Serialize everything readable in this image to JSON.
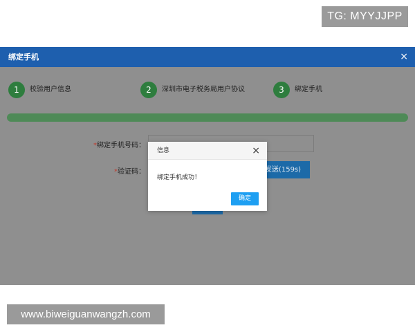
{
  "watermark_top": "TG: MYYJJPP",
  "watermark_bottom": "www.biweiguanwangzh.com",
  "main_dialog": {
    "title": "绑定手机",
    "close": "×"
  },
  "steps": [
    {
      "number": "1",
      "label": "校验用户信息"
    },
    {
      "number": "2",
      "label": "深圳市电子税务局用户协议"
    },
    {
      "number": "3",
      "label": "绑定手机"
    }
  ],
  "progress": {
    "fraction": 1.0
  },
  "form": {
    "required_mark": "*",
    "phone_label": "绑定手机号码：",
    "code_label": "验证码：",
    "resend_label": "新发送(159s)"
  },
  "message_box": {
    "title": "信息",
    "close": "×",
    "body": "绑定手机成功！",
    "ok_label": "确定"
  },
  "colors": {
    "header_blue": "#1e5fae",
    "step_green": "#2e7d3e",
    "progress_green": "#4e8a57",
    "ok_blue": "#1e9ff2",
    "required_red": "#c0392b"
  }
}
